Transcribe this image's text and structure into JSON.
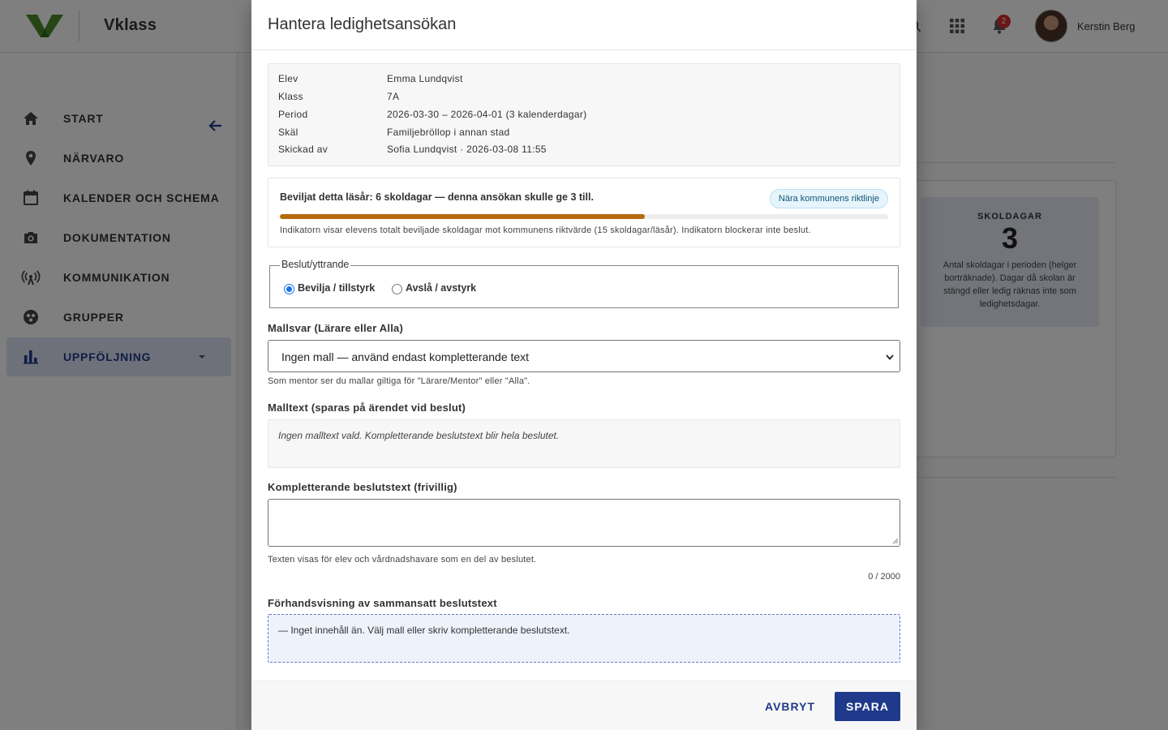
{
  "app": {
    "brand": "Vklass",
    "user_name": "Kerstin Berg",
    "notification_count": "2",
    "brand_color": "#4a8a2a",
    "accent_color": "#1f3a8a"
  },
  "sidebar": {
    "items": [
      {
        "label": "START",
        "icon": "home-icon"
      },
      {
        "label": "NÄRVARO",
        "icon": "location-pin-icon"
      },
      {
        "label": "KALENDER OCH SCHEMA",
        "icon": "calendar-icon"
      },
      {
        "label": "DOKUMENTATION",
        "icon": "camera-icon"
      },
      {
        "label": "KOMMUNIKATION",
        "icon": "broadcast-icon"
      },
      {
        "label": "GRUPPER",
        "icon": "groups-icon"
      },
      {
        "label": "UPPFÖLJNING",
        "icon": "bar-chart-icon",
        "active": true
      }
    ]
  },
  "stat": {
    "label": "SKOLDAGAR",
    "value": "3",
    "description": "Antal skoldagar i perioden (helger borträknade). Dagar då skolan är stängd eller ledig räknas inte som ledighetsdagar."
  },
  "modal": {
    "title": "Hantera ledighetsansökan",
    "info": [
      {
        "key": "Elev",
        "value": "Emma Lundqvist"
      },
      {
        "key": "Klass",
        "value": "7A"
      },
      {
        "key": "Period",
        "value": "2026-03-30 – 2026-04-01 (3 kalenderdagar)"
      },
      {
        "key": "Skäl",
        "value": "Familjebröllop i annan stad"
      },
      {
        "key": "Skickad av",
        "value": "Sofia Lundqvist · 2026-03-08 11:55"
      }
    ],
    "indicator": {
      "title": "Beviljat detta läsår: 6 skoldagar — denna ansökan skulle ge 3 till.",
      "chip": "Nära kommunens riktlinje",
      "progress_fraction": 0.6,
      "note": "Indikatorn visar elevens totalt beviljade skoldagar mot kommunens riktvärde (15 skoldagar/läsår). Indikatorn blockerar inte beslut."
    },
    "decision": {
      "legend": "Beslut/yttrande",
      "options": [
        {
          "label": "Bevilja / tillstyrk",
          "selected": true
        },
        {
          "label": "Avslå / avstyrk",
          "selected": false
        }
      ]
    },
    "template": {
      "label": "Mallsvar (Lärare eller Alla)",
      "selected": "Ingen mall — använd endast kompletterande text",
      "hint": "Som mentor ser du mallar giltiga för \"Lärare/Mentor\" eller \"Alla\"."
    },
    "template_text": {
      "label": "Malltext (sparas på ärendet vid beslut)",
      "value": "Ingen malltext vald. Kompletterande beslutstext blir hela beslutet."
    },
    "supplement": {
      "label": "Kompletterande beslutstext (frivillig)",
      "value": "",
      "hint": "Texten visas för elev och vårdnadshavare som en del av beslutet.",
      "counter": "0 / 2000"
    },
    "preview": {
      "label": "Förhandsvisning av sammansatt beslutstext",
      "value": "— Inget innehåll än. Välj mall eller skriv kompletterande beslutstext."
    },
    "footer": {
      "cancel": "AVBRYT",
      "save": "SPARA"
    }
  }
}
